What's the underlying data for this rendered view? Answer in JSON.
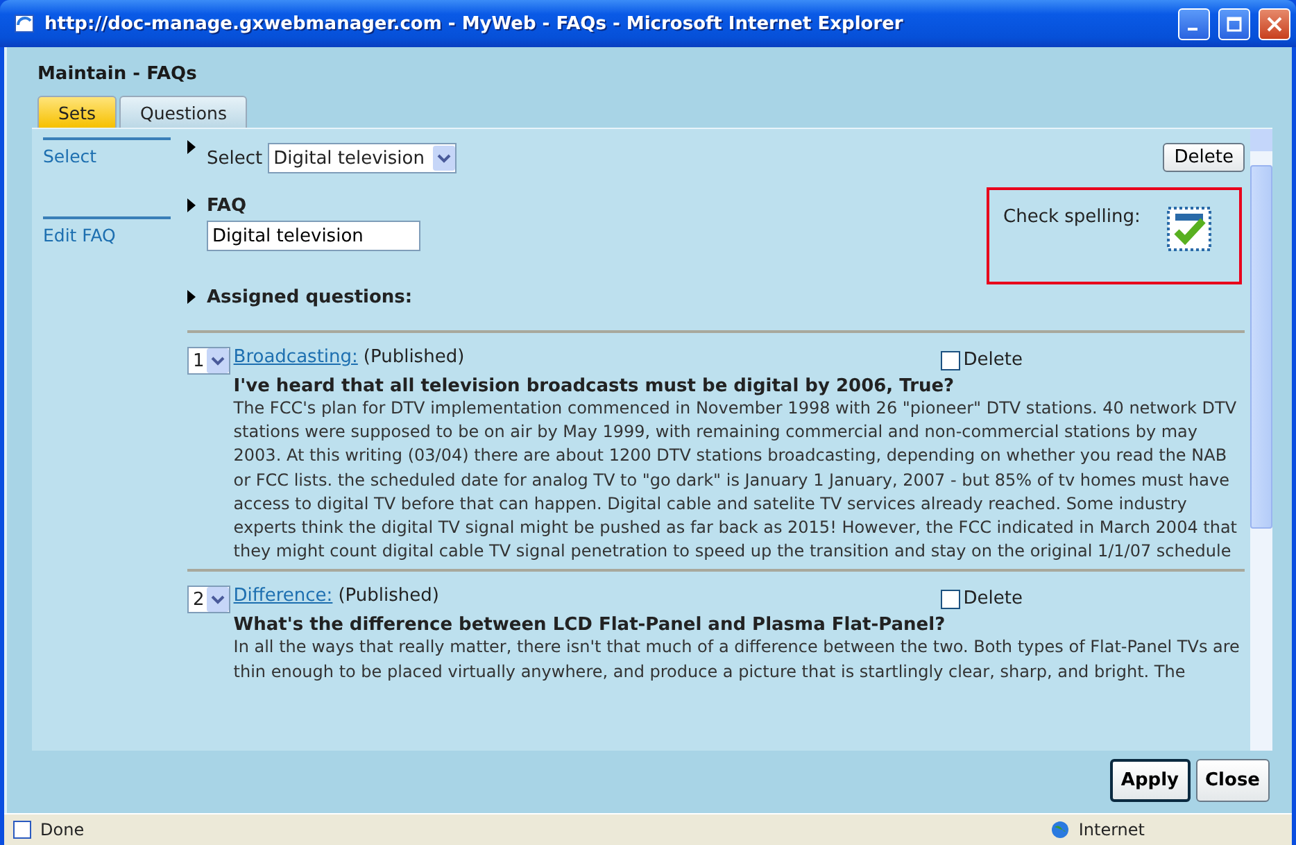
{
  "window": {
    "title": "http://doc-manage.gxwebmanager.com - MyWeb - FAQs - Microsoft Internet Explorer"
  },
  "page_title": "Maintain - FAQs",
  "tabs": [
    {
      "label": "Sets",
      "selected": true
    },
    {
      "label": "Questions",
      "selected": false
    }
  ],
  "sidebar": {
    "items": [
      {
        "label": "Select"
      },
      {
        "label": "Edit FAQ"
      }
    ]
  },
  "select_section": {
    "label": "Select",
    "value": "Digital television",
    "delete_button": "Delete"
  },
  "faq_section": {
    "heading": "FAQ",
    "value": "Digital television"
  },
  "spell_check": {
    "label": "Check spelling:"
  },
  "assigned": {
    "heading": "Assigned questions:"
  },
  "questions": [
    {
      "order": "1",
      "category": "Broadcasting:",
      "status": "(Published)",
      "delete_label": "Delete",
      "delete_checked": false,
      "title": "I've heard that all television broadcasts must be digital by 2006, True?",
      "body": "The FCC's plan for DTV implementation commenced in November 1998 with 26 \"pioneer\" DTV stations. 40 network DTV stations were supposed to be on air by May 1999, with remaining commercial and non-commercial stations by may 2003. At this writing (03/04) there are about 1200 DTV stations broadcasting, depending on whether you read the NAB or FCC lists. the scheduled date for analog TV to \"go dark\" is January 1 January, 2007 - but 85% of tv homes must have access to digital TV before that can happen. Digital cable and satelite TV services already reached. Some industry experts think the digital TV signal might be pushed as far back as 2015! However, the FCC indicated in March 2004 that they might count digital cable TV signal penetration to speed up the transition and stay on the original 1/1/07 schedule"
    },
    {
      "order": "2",
      "category": "Difference:",
      "status": "(Published)",
      "delete_label": "Delete",
      "delete_checked": false,
      "title": "What's the difference between LCD Flat-Panel and Plasma Flat-Panel?",
      "body": "In all the ways that really matter, there isn't that much of a difference between the two. Both types of Flat-Panel TVs are thin enough to be placed virtually anywhere, and produce a picture that is startlingly clear, sharp, and bright. The"
    }
  ],
  "buttons": [
    {
      "label": "Apply",
      "default": true
    },
    {
      "label": "Close",
      "default": false
    }
  ],
  "status_bar": {
    "status": "Done",
    "zone": "Internet"
  }
}
